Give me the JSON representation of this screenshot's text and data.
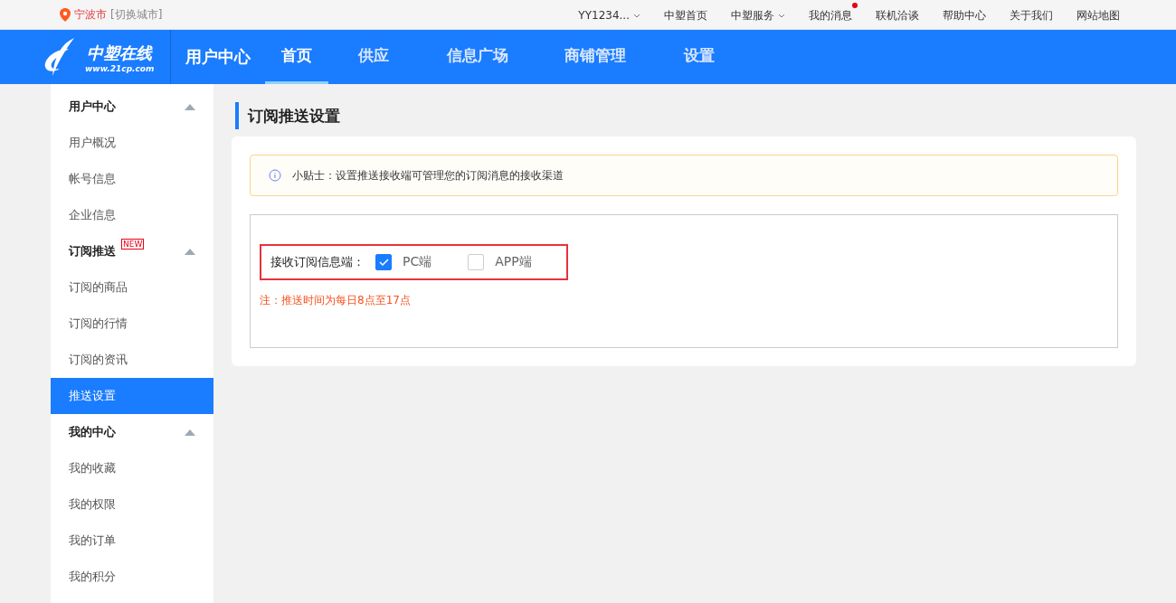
{
  "top_bar": {
    "city": "宁波市",
    "switch_city": "[切换城市]",
    "links": [
      {
        "label": "YY1234...",
        "dropdown": true,
        "badge": false
      },
      {
        "label": "中塑首页",
        "dropdown": false,
        "badge": false
      },
      {
        "label": "中塑服务",
        "dropdown": true,
        "badge": false
      },
      {
        "label": "我的消息",
        "dropdown": false,
        "badge": true
      },
      {
        "label": "联机洽谈",
        "dropdown": false,
        "badge": false
      },
      {
        "label": "帮助中心",
        "dropdown": false,
        "badge": false
      },
      {
        "label": "关于我们",
        "dropdown": false,
        "badge": false
      },
      {
        "label": "网站地图",
        "dropdown": false,
        "badge": false
      }
    ]
  },
  "header": {
    "logo_name": "中塑在线",
    "logo_url": "www.21cp.com",
    "section": "用户中心",
    "nav": [
      {
        "label": "首页",
        "selected": true
      },
      {
        "label": "供应",
        "selected": false
      },
      {
        "label": "信息广场",
        "selected": false
      },
      {
        "label": "商铺管理",
        "selected": false
      },
      {
        "label": "设置",
        "selected": false
      }
    ]
  },
  "sidebar": {
    "groups": [
      {
        "title": "用户中心",
        "expanded": true,
        "items": [
          {
            "label": "用户概况",
            "selected": false
          },
          {
            "label": "帐号信息",
            "selected": false
          },
          {
            "label": "企业信息",
            "selected": false
          }
        ]
      },
      {
        "title": "订阅推送",
        "badge": "NEW",
        "expanded": true,
        "items": [
          {
            "label": "订阅的商品",
            "selected": false
          },
          {
            "label": "订阅的行情",
            "selected": false
          },
          {
            "label": "订阅的资讯",
            "selected": false
          },
          {
            "label": "推送设置",
            "selected": true
          }
        ]
      },
      {
        "title": "我的中心",
        "expanded": true,
        "items": [
          {
            "label": "我的收藏",
            "selected": false
          },
          {
            "label": "我的权限",
            "selected": false
          },
          {
            "label": "我的订单",
            "selected": false
          },
          {
            "label": "我的积分",
            "selected": false
          }
        ]
      }
    ]
  },
  "main": {
    "title": "订阅推送设置",
    "tip": "小贴士：设置推送接收端可管理您的订阅消息的接收渠道",
    "receive_label": "接收订阅信息端：",
    "options": [
      {
        "label": "PC端",
        "checked": true
      },
      {
        "label": "APP端",
        "checked": false
      }
    ],
    "note": "注：推送时间为每日8点至17点"
  }
}
